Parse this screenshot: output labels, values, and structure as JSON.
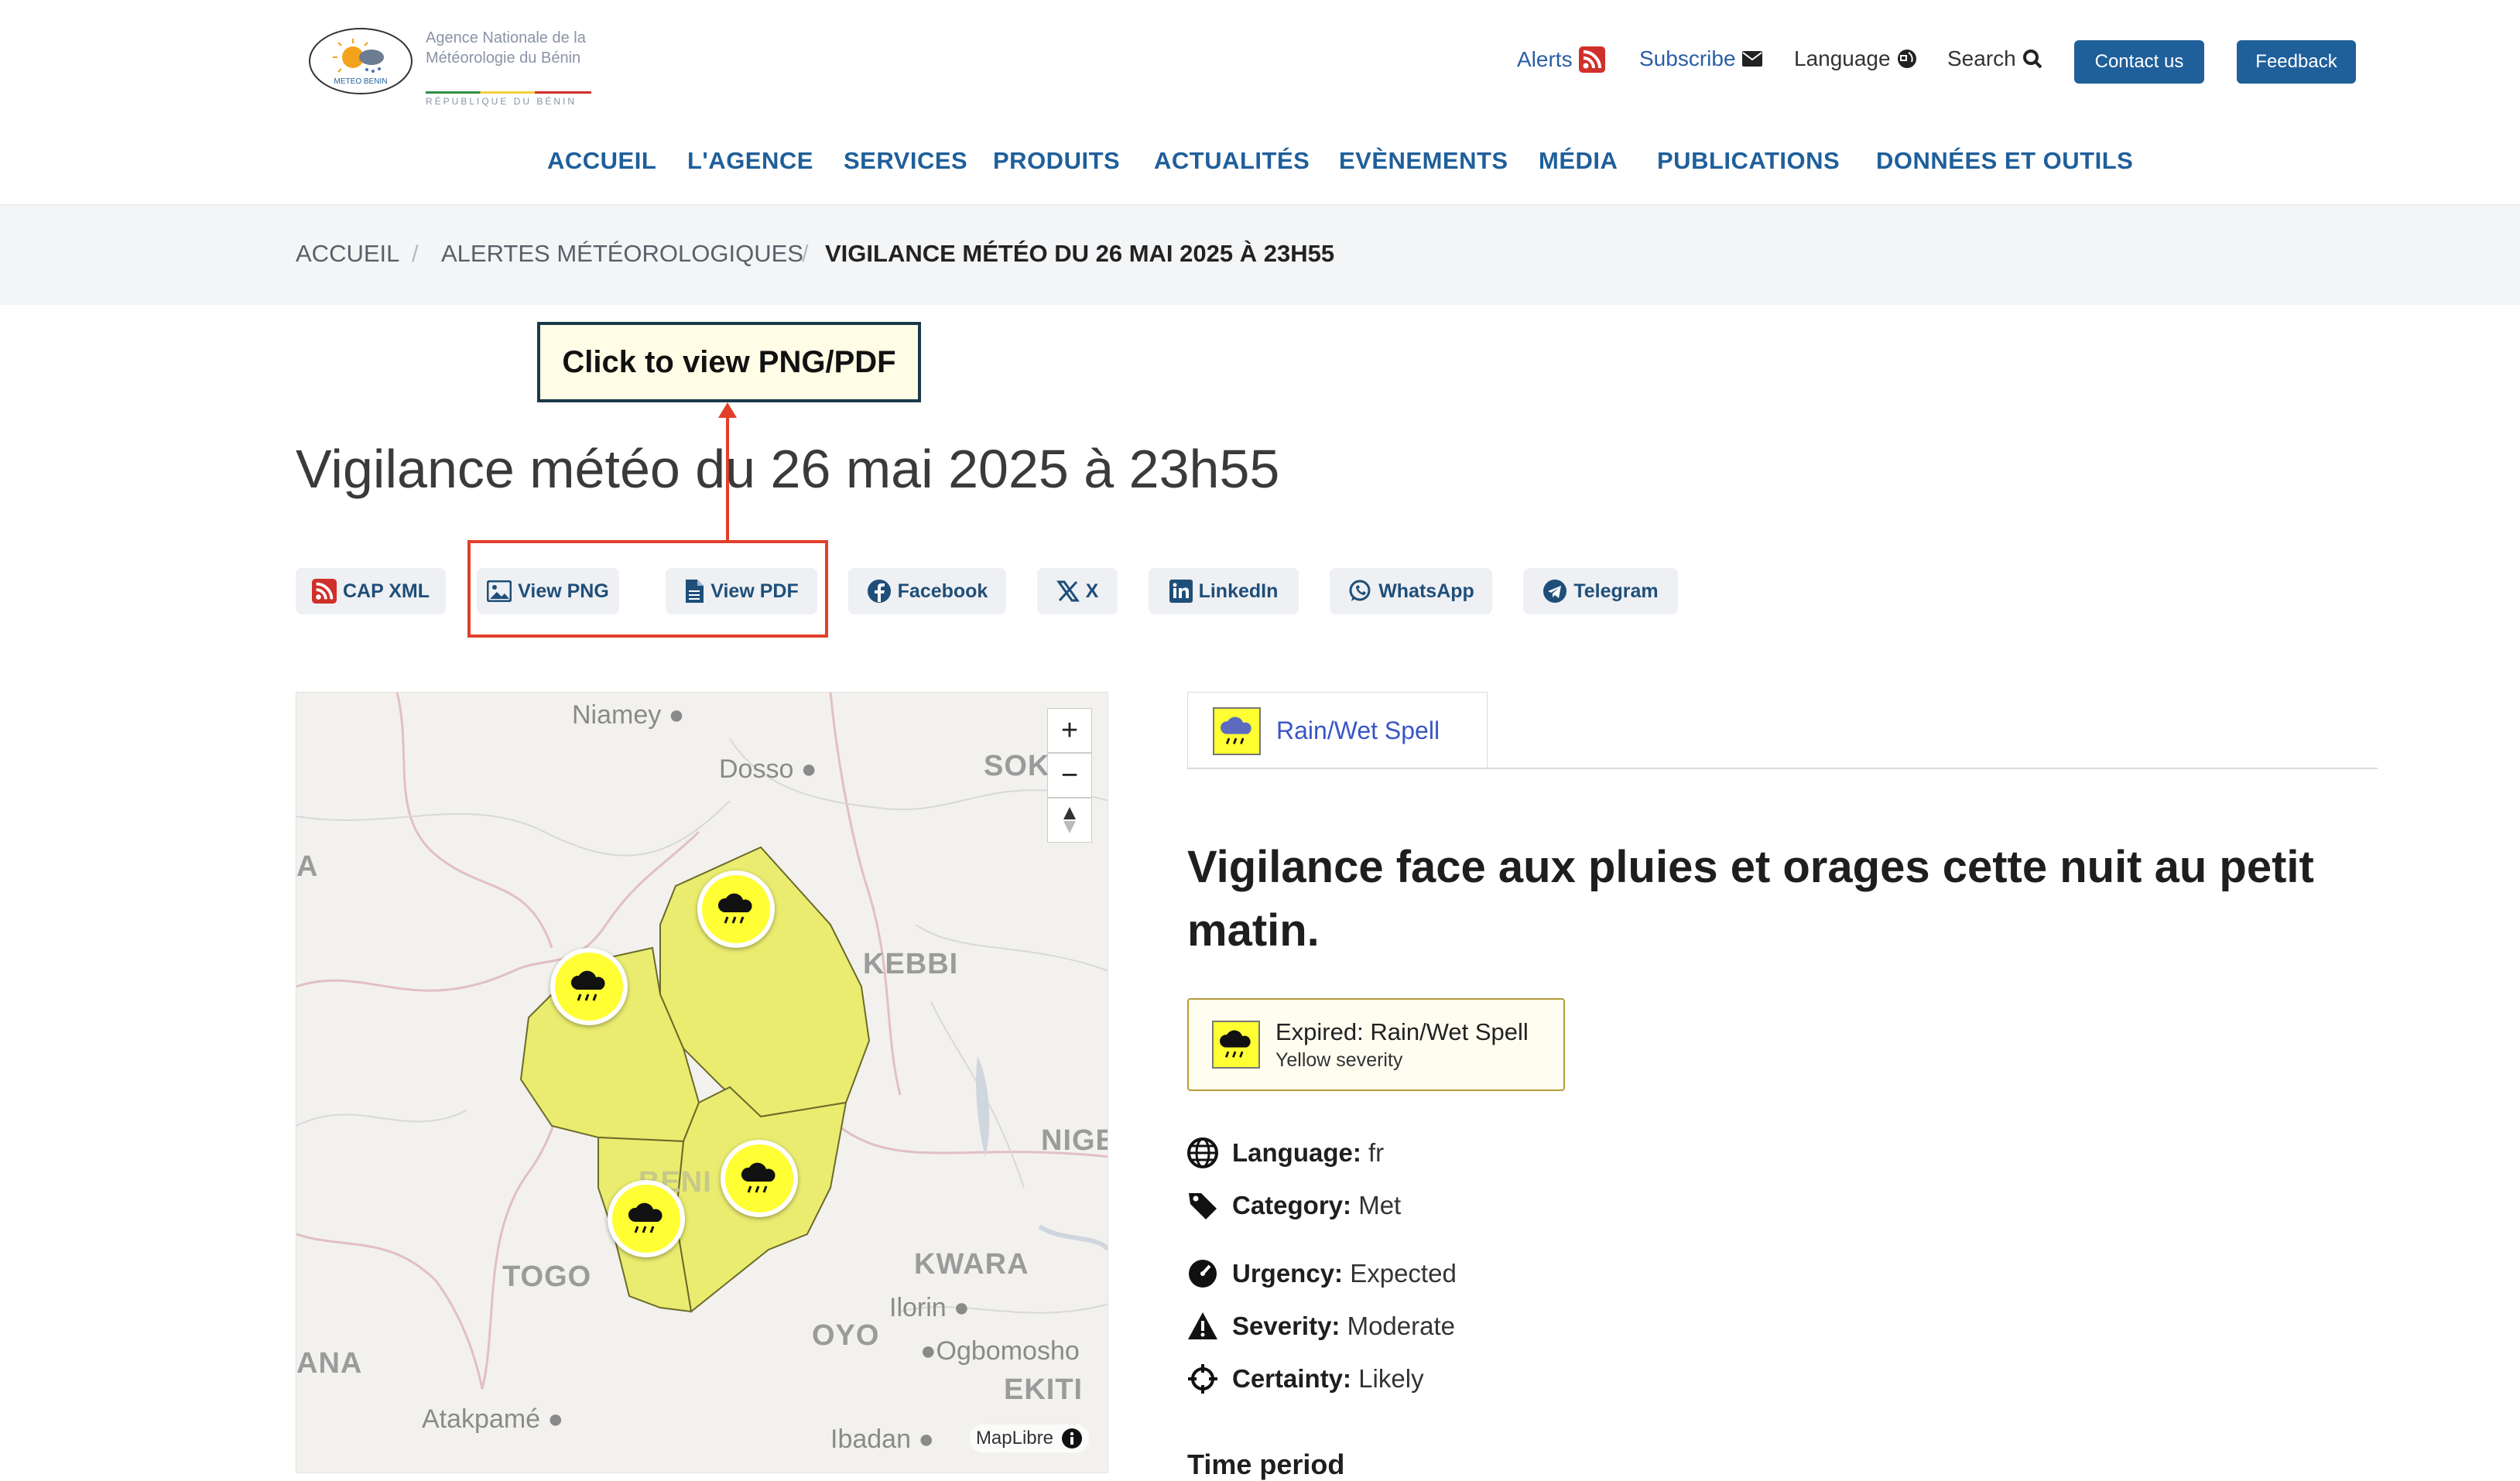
{
  "header": {
    "org_line1": "Agence Nationale de la",
    "org_line2": "Météorologie du Bénin",
    "org_line3": "RÉPUBLIQUE DU BÉNIN",
    "logo_text": "METEO BENIN",
    "links": {
      "alerts": "Alerts",
      "subscribe": "Subscribe",
      "language": "Language",
      "search": "Search"
    },
    "contact_button": "Contact us",
    "feedback_button": "Feedback"
  },
  "nav": [
    "ACCUEIL",
    "L'AGENCE",
    "SERVICES",
    "PRODUITS",
    "ACTUALITÉS",
    "EVÈNEMENTS",
    "MÉDIA",
    "PUBLICATIONS",
    "DONNÉES ET OUTILS"
  ],
  "breadcrumb": {
    "home": "ACCUEIL",
    "section": "ALERTES MÉTÉOROLOGIQUES",
    "current": "VIGILANCE MÉTÉO DU 26 MAI 2025 À 23H55",
    "separator": "/"
  },
  "callout": "Click to view PNG/PDF",
  "title": "Vigilance météo du 26 mai 2025 à 23h55",
  "share": {
    "cap_xml": "CAP XML",
    "view_png": "View PNG",
    "view_pdf": "View PDF",
    "facebook": "Facebook",
    "x": "X",
    "linkedin": "LinkedIn",
    "whatsapp": "WhatsApp",
    "telegram": "Telegram"
  },
  "map": {
    "labels": {
      "niamey": "Niamey",
      "dosso": "Dosso",
      "sokoto": "SOK O",
      "kebbi": "KEBBI",
      "niger": "NIGE",
      "kwara": "KWARA",
      "ilorin": "Ilorin",
      "oyo": "OYO",
      "ogbomosho": "Ogbomosho",
      "ekiti": "EKITI",
      "ibadan": "Ibadan",
      "togo": "TOGO",
      "ana": "ANA",
      "atakpame": "Atakpamé",
      "a": "A",
      "benin_partial": "BENI"
    },
    "zoom_in": "+",
    "zoom_out": "−",
    "attribution": "MapLibre",
    "alert_color": "#e9ec6f"
  },
  "tab": {
    "label": "Rain/Wet Spell"
  },
  "alert": {
    "headline": "Vigilance face aux pluies et orages cette nuit au petit matin.",
    "badge_title": "Expired: Rain/Wet Spell",
    "badge_subtitle": "Yellow severity",
    "properties": [
      {
        "key": "Language:",
        "value": "fr"
      },
      {
        "key": "Category:",
        "value": "Met"
      },
      {
        "key": "Urgency:",
        "value": "Expected"
      },
      {
        "key": "Severity:",
        "value": "Moderate"
      },
      {
        "key": "Certainty:",
        "value": "Likely"
      }
    ],
    "time_period": "Time period"
  }
}
